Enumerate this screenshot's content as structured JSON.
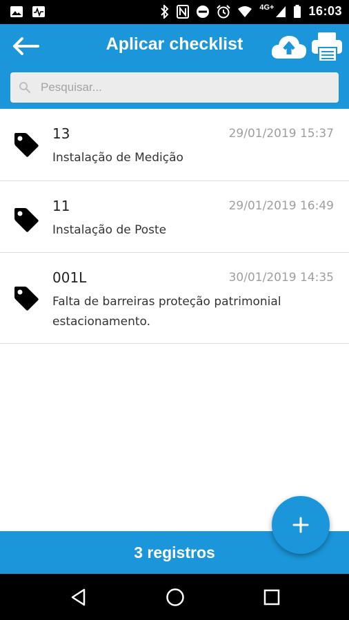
{
  "status_bar": {
    "time": "16:03",
    "network_label": "4G+",
    "icons": [
      "image-icon",
      "activity-icon",
      "bluetooth-icon",
      "nfc-icon",
      "do-not-disturb-icon",
      "alarm-icon",
      "wifi-icon",
      "signal-icon",
      "battery-icon"
    ]
  },
  "app_bar": {
    "title": "Aplicar checklist",
    "back_icon": "arrow-left-icon",
    "actions": [
      "cloud-upload-icon",
      "printer-icon"
    ],
    "search_placeholder": "Pesquisar..."
  },
  "items": [
    {
      "code": "13",
      "date": "29/01/2019 15:37",
      "description": "Instalação de Medição",
      "icon": "tag-icon"
    },
    {
      "code": "11",
      "date": "29/01/2019 16:49",
      "description": "Instalação de Poste",
      "icon": "tag-icon"
    },
    {
      "code": "001L",
      "date": "30/01/2019 14:35",
      "description": "Falta de barreiras proteção patrimonial estacionamento.",
      "icon": "tag-icon"
    }
  ],
  "footer": {
    "count_label": "3 registros"
  },
  "fab": {
    "icon": "plus-icon"
  },
  "colors": {
    "primary": "#1b96da",
    "search_bg": "#ececec",
    "date_text": "#9e9e9e",
    "divider": "#dcdcdc"
  }
}
